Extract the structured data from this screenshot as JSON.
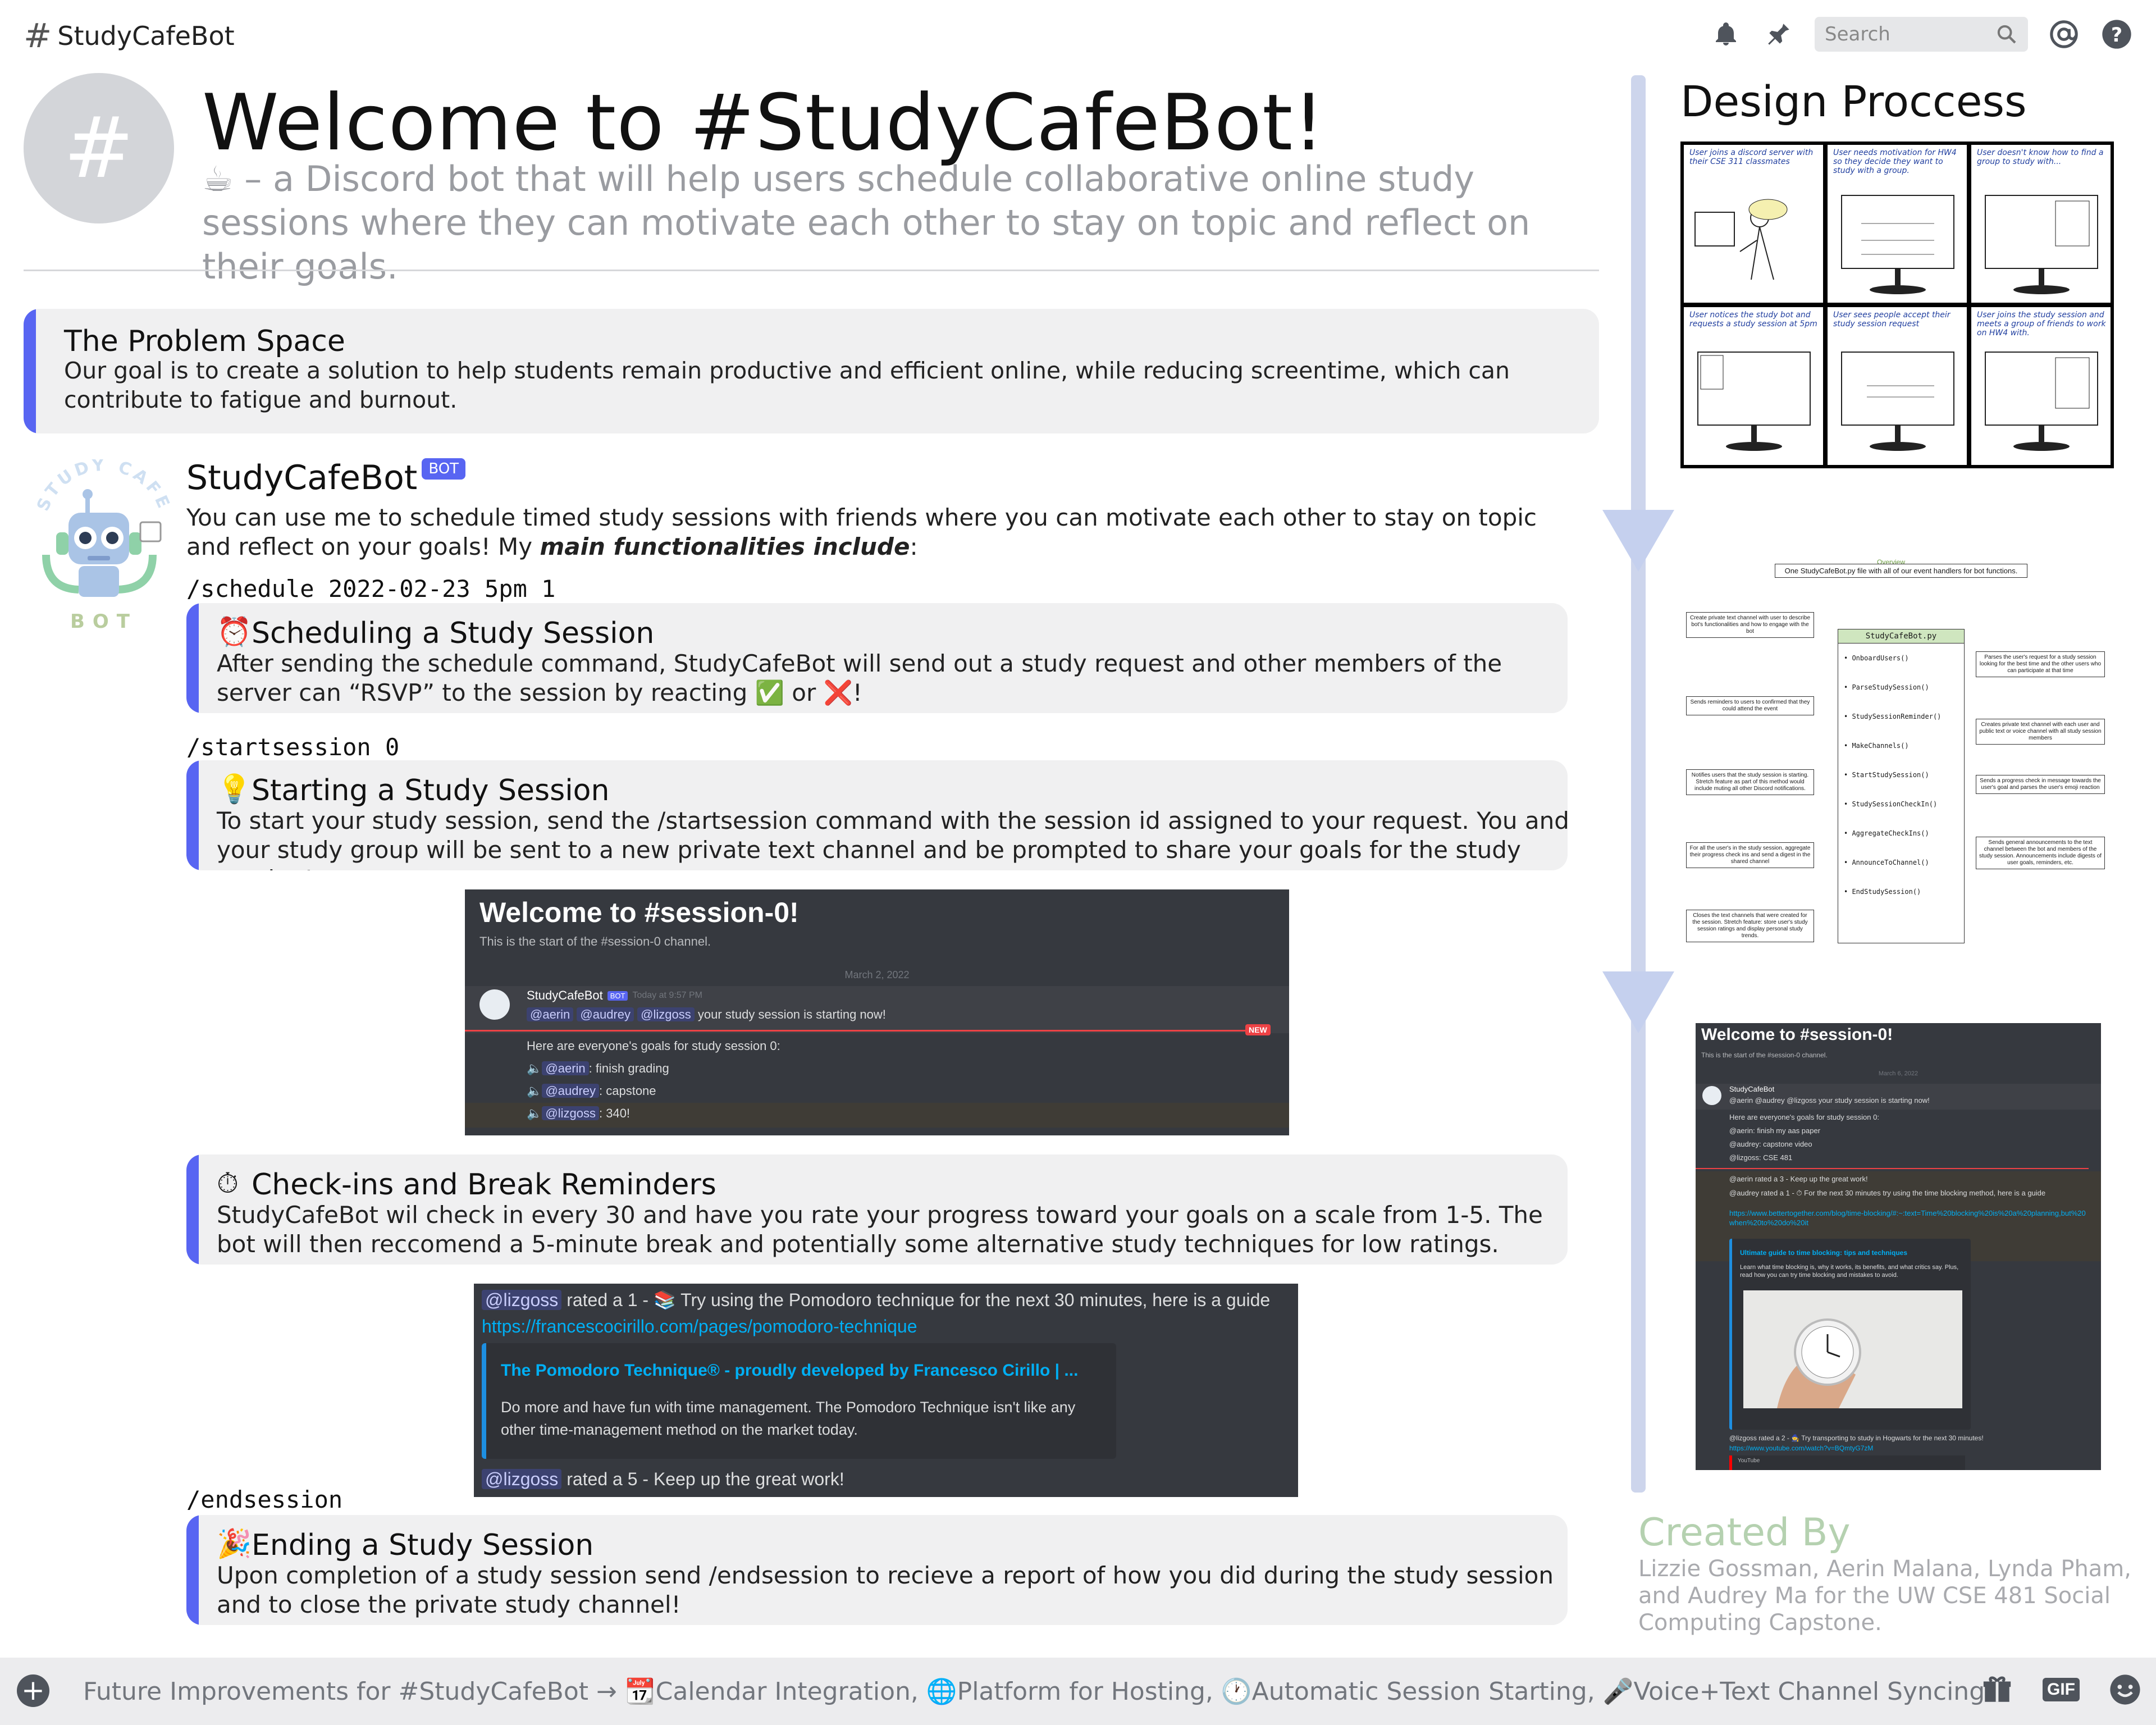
{
  "header": {
    "channel_name": "StudyCafeBot",
    "search_placeholder": "Search"
  },
  "welcome": {
    "hash": "#",
    "title": "Welcome to #StudyCafeBot!",
    "description": "☕ – a Discord bot that will help users schedule collaborative online study sessions where they can motivate each other to stay on topic and reflect on their goals."
  },
  "problem": {
    "heading": "The Problem Space",
    "text": "Our goal is to create a solution to help students remain productive and efficient online, while reducing screentime, which can contribute to fatigue and burnout."
  },
  "bot": {
    "name": "StudyCafeBot",
    "badge": "BOT",
    "avatar_top_text": "STUDY CAFE",
    "avatar_bottom_text": "BOT",
    "intro_prefix": "You can use me to schedule timed study sessions with friends where you can motivate each other to stay on topic and reflect on your goals! My ",
    "intro_emph": "main functionalities include",
    "intro_suffix": ":"
  },
  "features": {
    "schedule_cmd": "/schedule 2022-02-23 5pm 1",
    "schedule_emoji": "⏰",
    "schedule_title": "Scheduling a Study Session",
    "schedule_text_a": "After sending the schedule command, StudyCafeBot will send out a study request and other members of the server can “RSVP” to the session by reacting ",
    "schedule_check": "✅",
    "schedule_or": " or ",
    "schedule_x": "❌",
    "schedule_end": "!",
    "start_cmd": "/startsession 0",
    "start_emoji": "💡",
    "start_title": "Starting a Study Session",
    "start_text": "To start your study session, send the /startsession command with the session id assigned to your request. You and your study group will be sent to a new private text channel and be prompted to share your goals for the study session!",
    "checkin_emoji": "⏱",
    "checkin_title": "Check-ins and Break Reminders",
    "checkin_text": "StudyCafeBot wil check in every 30 and have you rate your progress toward your goals on a scale from 1-5. The bot will then reccomend a 5-minute break and potentially some alternative study techniques for low ratings.",
    "end_cmd": "/endsession",
    "end_emoji": "🎉",
    "end_title": "Ending a Study Session",
    "end_text": "Upon completion of a study session send /endsession to recieve a report of how you did during the study session and to close the private study channel!"
  },
  "session_screenshot": {
    "title": "Welcome to #session-0!",
    "subtitle": "This is the start of the #session-0 channel.",
    "date": "March 2, 2022",
    "bot_name": "StudyCafeBot",
    "badge": "BOT",
    "time": "Today at 9:57 PM",
    "m1": "@aerin",
    "m2": "@audrey",
    "m3": "@lizgoss",
    "msg": "your study session is starting now!",
    "new_label": "NEW",
    "goals_intro": "Here are everyone's goals for study session 0:",
    "g1": ": finish grading",
    "g2": ": capstone",
    "g3": ": 340!"
  },
  "pomodoro_screenshot": {
    "user": "@lizgoss",
    "line1": "rated a 1 - 📚 Try using the Pomodoro technique for the next 30 minutes, here is a guide",
    "link": "https://francescocirillo.com/pages/pomodoro-technique",
    "embed_title": "The Pomodoro Technique® - proudly developed by Francesco Cirillo | ...",
    "embed_desc": "Do more and have fun with time management. The Pomodoro Technique isn't like any other time-management method on the market today.",
    "line2": "rated a 5 - Keep up the great work!"
  },
  "design": {
    "title": "Design Proccess",
    "comic": [
      "User joins a discord server with their CSE 311 classmates",
      "User needs motivation for HW4 so they decide they want to study with a group.",
      "User doesn't know how to find a group to study with...",
      "User notices the study bot and requests a study session at 5pm",
      "User sees people accept their study session request",
      "User joins the study session and meets a group of friends to work on HW4 with."
    ],
    "arch_overview": "Overview",
    "arch_top": "One StudyCafeBot.py file with all of our event handlers for bot functions.",
    "arch_center": "StudyCafeBot.py",
    "arch_funcs": [
      "OnboardUsers()",
      "ParseStudySession()",
      "StudySessionReminder()",
      "MakeChannels()",
      "StartStudySession()",
      "StudySessionCheckIn()",
      "AggregateCheckIns()",
      "AnnounceToChannel()",
      "EndStudySession()"
    ],
    "arch_left": [
      "Create private text channel with user to describe bot's functionalities and how to engage with the bot",
      "Sends reminders to users to confirmed that they could attend the event",
      "Notifies users that the study session is starting. Stretch feature as part of this method would include muting all other Discord notifications.",
      "For all the user's in the study session, aggregate their progress check ins and send a digest in the shared channel",
      "Closes the text channels that were created for the session. Stretch feature: store user's study session ratings and display personal study trends."
    ],
    "arch_right": [
      "Parses the user's request for a study session looking for the best time and the other users who can participate at that time",
      "Creates private text channel with each user and public text or voice channel with all study session members",
      "Sends a progress check in message towards the user's goal and parses the user's emoji reaction",
      "Sends general announcements to the text channel between the bot and members of the study session. Announcements include digests of user goals, reminders, etc."
    ],
    "shot": {
      "title": "Welcome to #session-0!",
      "subtitle": "This is the start of the #session-0 channel.",
      "date": "March 6, 2022",
      "bot_name": "StudyCafeBot",
      "msg": "@aerin @audrey @lizgoss your study session is starting now!",
      "goals_intro": "Here are everyone's goals for study session 0:",
      "g1": "@aerin: finish my aas paper",
      "g2": "@audrey: capstone video",
      "g3": "@lizgoss: CSE 481",
      "r1": "@aerin rated a 3 - Keep up the great work!",
      "r2": "@audrey rated a 1 - ⏱ For the next 30 minutes try using the time blocking method, here is a guide",
      "link": "https://www.bettertogether.com/blog/time-blocking/#:~:text=Time%20blocking%20is%20a%20planning,but%20when%20to%20do%20it",
      "embed_title": "Ultimate guide to time blocking: tips and techniques",
      "embed_desc": "Learn what time blocking is, why it works, its benefits, and what critics say. Plus, read how you can try time blocking and mistakes to avoid.",
      "r3": "@lizgoss rated a 2 - 🧙 Try transporting to study in Hogwarts for the next 30 minutes!",
      "link2": "https://www.youtube.com/watch?v=BQmtyG7zM",
      "youtube": "YouTube"
    }
  },
  "credits": {
    "heading": "Created By",
    "text": "Lizzie Gossman, Aerin Malana, Lynda Pham, and Audrey Ma for the UW CSE 481 Social Computing Capstone."
  },
  "footer": {
    "text": "Future Improvements for #StudyCafeBot → 📆Calendar Integration, 🌐Platform for Hosting, 🕐Automatic Session Starting, 🎤Voice+Text Channel Syncing",
    "gif_label": "GIF"
  },
  "colors": {
    "accent": "#5865f2",
    "discord_dark": "#36393f",
    "timeline": "#cdd5ec",
    "created_by": "#b5d1b0"
  }
}
